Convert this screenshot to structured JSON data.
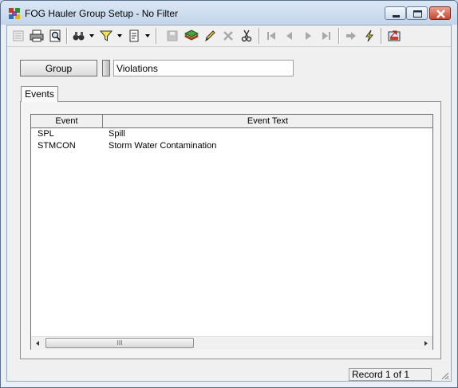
{
  "window": {
    "title": "FOG Hauler Group Setup - No Filter",
    "controls": [
      "minimize",
      "maximize",
      "close"
    ]
  },
  "toolbar": {
    "buttons": [
      {
        "icon": "list-view-icon",
        "enabled": false
      },
      {
        "icon": "print-icon",
        "enabled": true
      },
      {
        "icon": "print-preview-icon",
        "enabled": true
      },
      {
        "icon": "find-icon",
        "enabled": true,
        "dropdown": true
      },
      {
        "icon": "filter-icon",
        "enabled": true,
        "dropdown": true
      },
      {
        "icon": "report-icon",
        "enabled": true,
        "dropdown": true
      },
      {
        "icon": "save-icon",
        "enabled": false
      },
      {
        "icon": "add-record-icon",
        "enabled": true
      },
      {
        "icon": "edit-icon",
        "enabled": true
      },
      {
        "icon": "delete-icon",
        "enabled": false
      },
      {
        "icon": "cut-icon",
        "enabled": true
      },
      {
        "icon": "first-record-icon",
        "enabled": false
      },
      {
        "icon": "previous-record-icon",
        "enabled": false
      },
      {
        "icon": "next-record-icon",
        "enabled": false
      },
      {
        "icon": "last-record-icon",
        "enabled": false
      },
      {
        "icon": "goto-icon",
        "enabled": false
      },
      {
        "icon": "lightning-icon",
        "enabled": true
      },
      {
        "icon": "exit-icon",
        "enabled": true
      }
    ]
  },
  "form": {
    "group_button": "Group",
    "group_value": "Violations"
  },
  "tabs": [
    {
      "label": "Events",
      "active": true
    }
  ],
  "grid": {
    "columns": [
      "Event",
      "Event Text"
    ],
    "rows": [
      {
        "event": "SPL",
        "text": "Spill"
      },
      {
        "event": "STMCON",
        "text": "Storm Water Contamination"
      }
    ],
    "scroll_thumb_glyph": "III"
  },
  "status": {
    "record": "Record 1 of 1"
  },
  "colors": {
    "disabled_icon": "#a8a8a8",
    "title_bar": "#c3d5ea",
    "close_button": "#c9452e"
  }
}
